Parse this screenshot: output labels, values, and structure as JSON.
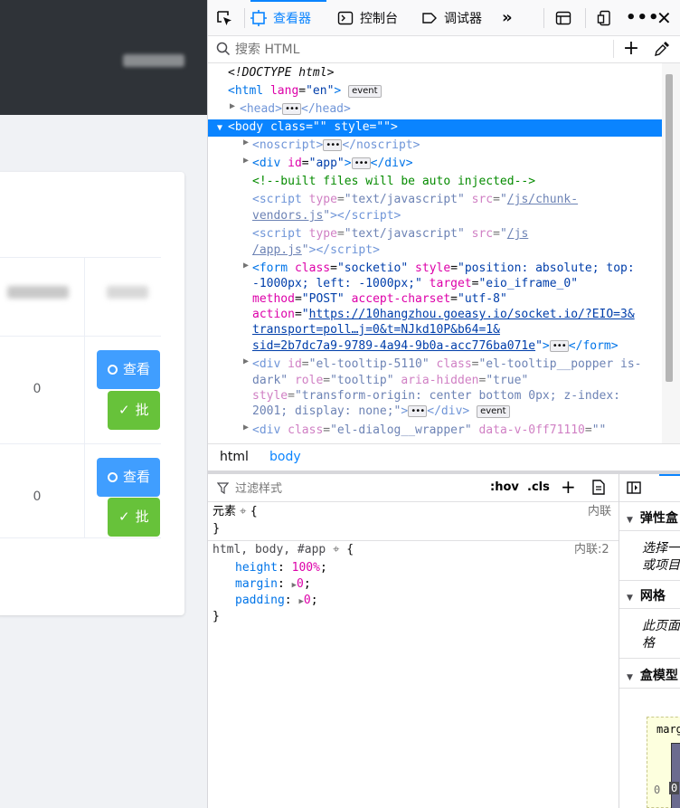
{
  "page": {
    "rows": [
      {
        "count": "0"
      },
      {
        "count": "0"
      }
    ],
    "view_label": "查看",
    "ok_label": "批"
  },
  "toolbar": {
    "inspector": "查看器",
    "console": "控制台",
    "debugger": "调试器"
  },
  "search": {
    "placeholder": "搜索 HTML"
  },
  "markup": {
    "doctype": "<!DOCTYPE html>",
    "comment": "<!--built files will be auto injected-->",
    "src_vendors_1": "/js/chunk-",
    "src_vendors_2": "vendors.js",
    "src_app_1": "/js",
    "src_app_2": "/app.js",
    "form_style_1": "\"position: absolute; top:",
    "form_style_2": "-1000px; left: -1000px;\"",
    "form_target": "\"eio_iframe_0\"",
    "form_action_1": "https://10hangzhou.goeasy.io/socket.io/?EIO=3&",
    "form_action_2": "transport=poll…j=0&t=NJkd10P&b64=1&",
    "form_action_3": "sid=2b7dc7a9-9789-4a94-9b0a-acc776ba071e",
    "tooltip_id": "\"el-tooltip-5110\"",
    "tooltip_class_1": "\"el-tooltip__popper is-",
    "tooltip_class_2": "dark\"",
    "tooltip_style_1": "\"transform-origin: center bottom 0px; z-index:",
    "tooltip_style_2": "2001; display: none;\"",
    "dialog_class": "\"el-dialog__wrapper\"",
    "dialog_attr": "data-v-0ff71110",
    "event_badge": "event"
  },
  "breadcrumb": [
    "html",
    "body"
  ],
  "rules": {
    "filter_placeholder": "过滤样式",
    "hov": ":hov",
    "cls": ".cls",
    "element_label": "元素",
    "inline_label": "内联",
    "selector": "html, body, #app",
    "source": "内联:2",
    "props": [
      {
        "name": "height",
        "value": "100%"
      },
      {
        "name": "margin",
        "value": "0"
      },
      {
        "name": "padding",
        "value": "0"
      }
    ]
  },
  "layout": {
    "flex_title": "弹性盒",
    "flex_desc_1": "选择一",
    "flex_desc_2": "或项目",
    "grid_title": "网格",
    "grid_desc_1": "此页面",
    "grid_desc_2": "格",
    "box_title": "盒模型",
    "margin_label": "marg",
    "zero": "0"
  }
}
